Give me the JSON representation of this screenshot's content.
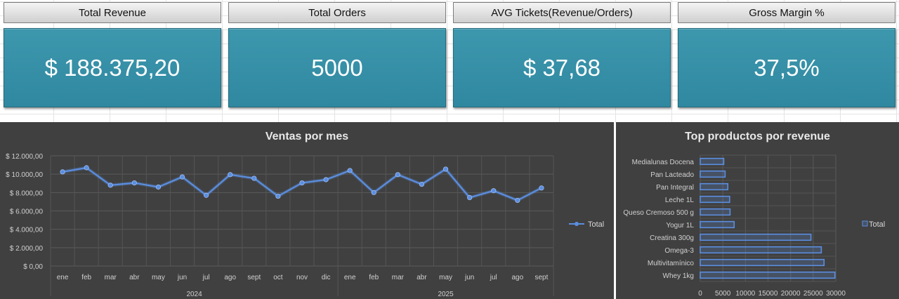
{
  "kpis": [
    {
      "header": "Total Revenue",
      "value": "$ 188.375,20"
    },
    {
      "header": "Total Orders",
      "value": "5000"
    },
    {
      "header": "AVG Tickets(Revenue/Orders)",
      "value": "$ 37,68"
    },
    {
      "header": "Gross Margin %",
      "value": "37,5%"
    }
  ],
  "colors": {
    "kpi_fill": "#3392a8",
    "panel_bg": "#404040",
    "series": "#5b8ee0"
  },
  "chart_data": [
    {
      "type": "line",
      "title": "Ventas por mes",
      "categories": [
        "ene",
        "feb",
        "mar",
        "abr",
        "may",
        "jun",
        "jul",
        "ago",
        "sept",
        "oct",
        "nov",
        "dic",
        "ene",
        "feb",
        "mar",
        "abr",
        "may",
        "jun",
        "jul",
        "ago",
        "sept"
      ],
      "groups": [
        {
          "label": "2024",
          "start": 0,
          "end": 11
        },
        {
          "label": "2025",
          "start": 12,
          "end": 20
        }
      ],
      "series": [
        {
          "name": "Total",
          "values": [
            10250,
            10700,
            8800,
            9050,
            8600,
            9700,
            7700,
            9950,
            9550,
            7600,
            9050,
            9400,
            10400,
            8000,
            9950,
            8900,
            10550,
            7450,
            8200,
            7150,
            8500
          ]
        }
      ],
      "yticks": [
        "$ 0,00",
        "$ 2.000,00",
        "$ 4.000,00",
        "$ 6.000,00",
        "$ 8.000,00",
        "$ 10.000,00",
        "$ 12.000,00"
      ],
      "ylim": [
        0,
        12000
      ],
      "grid": true,
      "legend": "right"
    },
    {
      "type": "bar",
      "title": "Top productos por revenue",
      "categories": [
        "Medialunas Docena",
        "Pan Lacteado",
        "Pan Integral",
        "Leche 1L",
        "Queso Cremoso 500 g",
        "Yogur 1L",
        "Creatina 300g",
        "Omega-3",
        "Multivitamínico",
        "Whey 1kg"
      ],
      "series": [
        {
          "name": "Total",
          "values": [
            5200,
            5500,
            6100,
            6500,
            6600,
            7500,
            24500,
            26800,
            27400,
            29800
          ]
        }
      ],
      "xticks": [
        "0",
        "5000",
        "10000",
        "15000",
        "20000",
        "25000",
        "30000"
      ],
      "xlim": [
        0,
        30000
      ],
      "grid": true,
      "legend": "right"
    }
  ]
}
